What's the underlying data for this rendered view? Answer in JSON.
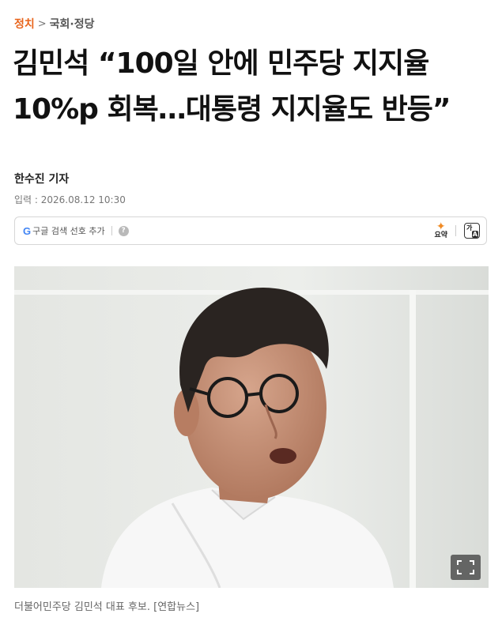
{
  "breadcrumb": {
    "section": "정치",
    "separator": ">",
    "subsection": "국회·정당"
  },
  "article": {
    "title_line1": "김민석 “100일 안에 민주당 지지율",
    "title_line2": "10%p 회복…대통령 지지율도 반등”",
    "reporter": "한수진 기자",
    "dateline": "입력 : 2026.08.12 10:30"
  },
  "toolbar": {
    "google_icon": "G",
    "google_pref_label": "구글 검색 선호 추가",
    "help_icon": "?",
    "summary_label": "요약",
    "translate_glyph_1": "가",
    "translate_glyph_2": "A"
  },
  "photo": {
    "caption": "더불어민주당 김민석 대표 후보. [연합뉴스]"
  },
  "icons": {
    "google": "google-g-icon",
    "help": "question-circle-icon",
    "summary": "sparkle-icon",
    "translate": "translate-icon",
    "expand": "fullscreen-expand-icon"
  },
  "colors": {
    "accent": "#e8641b",
    "google_blue": "#4285f4",
    "sparkle": "#f08a24"
  }
}
